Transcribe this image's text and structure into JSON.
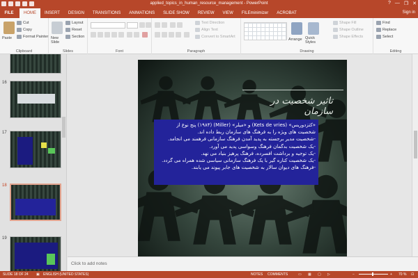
{
  "window": {
    "title": "applied_topics_in_human_resource_management - PowerPoint",
    "help": "?",
    "minimize": "—",
    "restore": "❐",
    "close": "✕"
  },
  "ribbon": {
    "file_tab": "FILE",
    "tabs": [
      "HOME",
      "INSERT",
      "DESIGN",
      "TRANSITIONS",
      "ANIMATIONS",
      "SLIDE SHOW",
      "REVIEW",
      "VIEW",
      "FILEminimizer",
      "ACROBAT"
    ],
    "active_tab": "HOME",
    "sign_in": "Sign in",
    "clipboard": {
      "label": "Clipboard",
      "paste": "Paste",
      "cut": "Cut",
      "copy": "Copy",
      "format_painter": "Format Painter"
    },
    "slides": {
      "label": "Slides",
      "new_slide": "New Slide",
      "layout": "Layout",
      "reset": "Reset",
      "section": "Section"
    },
    "font": {
      "label": "Font"
    },
    "paragraph": {
      "label": "Paragraph",
      "text_direction": "Text Direction",
      "align_text": "Align Text",
      "convert_smartart": "Convert to SmartArt"
    },
    "drawing": {
      "label": "Drawing",
      "arrange": "Arrange",
      "quick_styles": "Quick Styles",
      "shape_fill": "Shape Fill",
      "shape_outline": "Shape Outline",
      "shape_effects": "Shape Effects"
    },
    "editing": {
      "label": "Editing",
      "find": "Find",
      "replace": "Replace",
      "select": "Select"
    }
  },
  "thumbnails": [
    {
      "number": "16",
      "selected": false
    },
    {
      "number": "17",
      "selected": false
    },
    {
      "number": "18",
      "selected": true
    },
    {
      "number": "19",
      "selected": false
    }
  ],
  "slide": {
    "title": "تاثیر شخصیت در سازمان",
    "bullets": [
      "«کتزدوریس» (Kets de vries) و «میلر» (Miller) (۱۹۸۴) پنج نوع از",
      "شخصیت های ویژه را به فرهنگ های سازمان ربط داده اند.",
      "-شخصیت مدیر برجسته به پدید آمدن فرهنگ سازمانی فرهمند می انجامد.",
      "-یک شخصیت بدگمان فرهنگ وسواسی پدید می آورد.",
      "-یک توجیه و برداشت افسرده، فرهنگ پرهیز بنیاد می نهد.",
      "-یک شخصیت کناره گیر با یک فرهنگ سازمانی سیاسی شده همراه می گردد.",
      "-فرهنگ های دیوان سالار به شخصیت های جابر پیوند می یابند."
    ]
  },
  "notes": {
    "placeholder": "Click to add notes"
  },
  "status": {
    "slide_info": "SLIDE 18 OF 24",
    "language": "ENGLISH (UNITED STATES)",
    "notes": "NOTES",
    "comments": "COMMENTS",
    "zoom": "70 %",
    "zoom_minus": "−",
    "zoom_plus": "+"
  },
  "colors": {
    "accent": "#b7472a",
    "textbox": "#23239a",
    "slide_bg": "#1d2a24"
  }
}
